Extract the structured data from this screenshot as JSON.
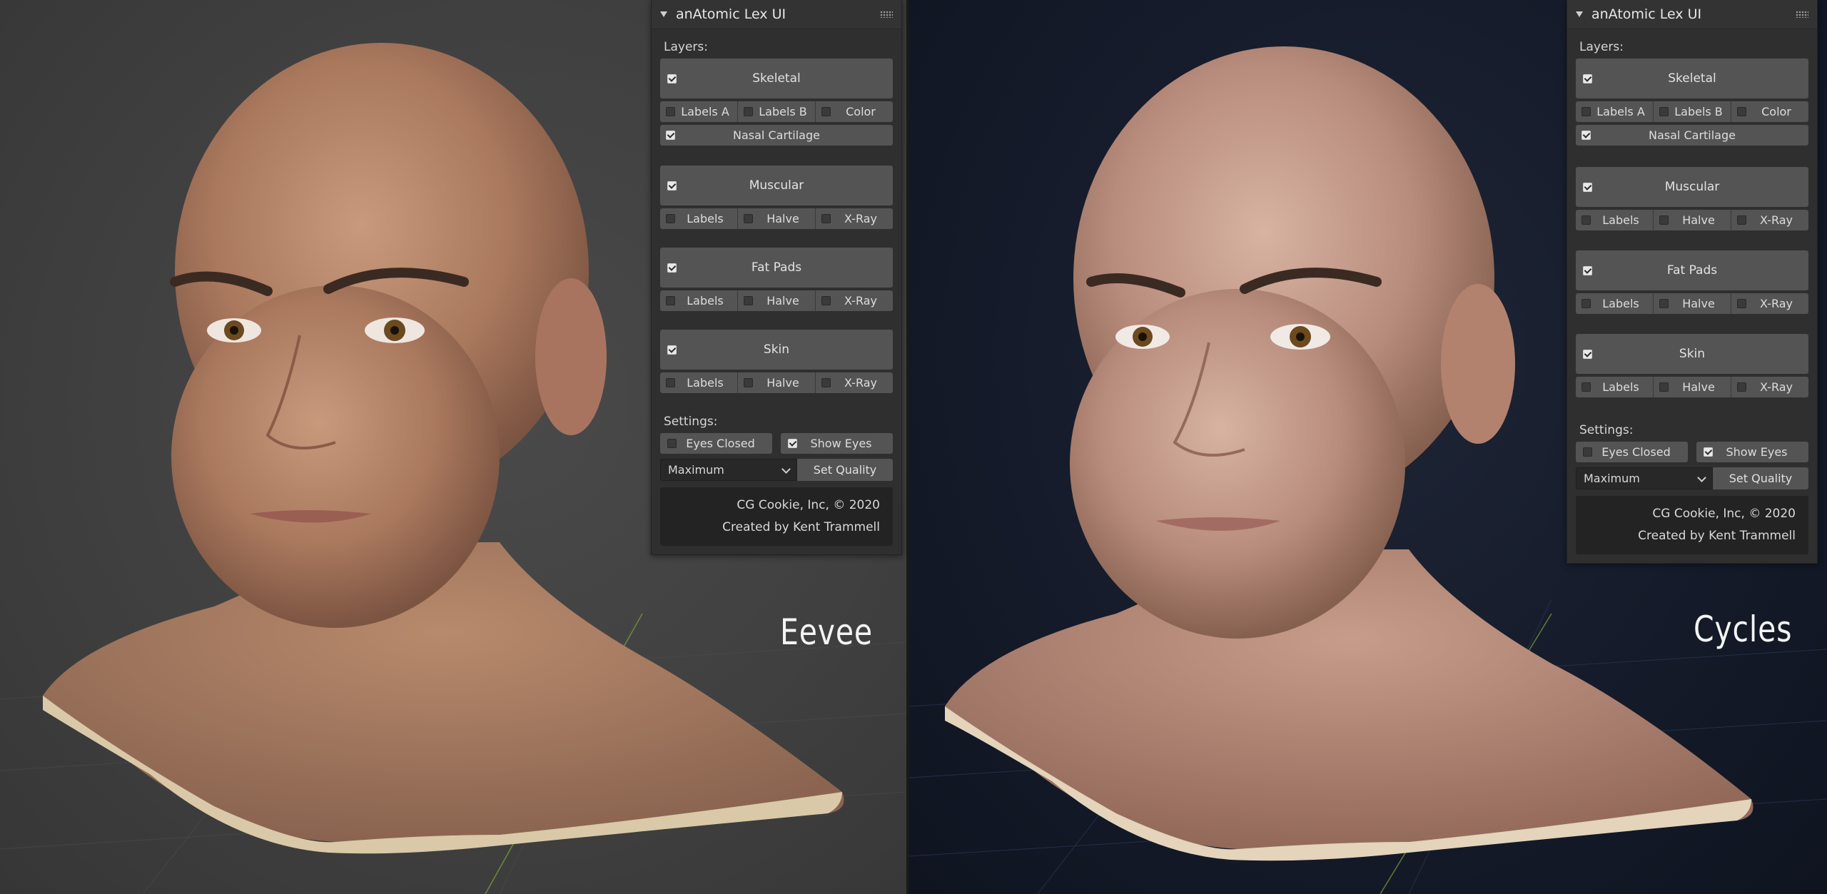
{
  "left": {
    "render_label": "Eevee",
    "panel": {
      "title": "anAtomic Lex UI",
      "layers_label": "Layers:",
      "layers": [
        {
          "name": "Skeletal",
          "checked": true,
          "options": [
            {
              "label": "Labels A",
              "checked": false
            },
            {
              "label": "Labels B",
              "checked": false
            },
            {
              "label": "Color",
              "checked": false
            }
          ],
          "extra": {
            "label": "Nasal Cartilage",
            "checked": true
          }
        },
        {
          "name": "Muscular",
          "checked": true,
          "options": [
            {
              "label": "Labels",
              "checked": false
            },
            {
              "label": "Halve",
              "checked": false
            },
            {
              "label": "X-Ray",
              "checked": false
            }
          ]
        },
        {
          "name": "Fat Pads",
          "checked": true,
          "options": [
            {
              "label": "Labels",
              "checked": false
            },
            {
              "label": "Halve",
              "checked": false
            },
            {
              "label": "X-Ray",
              "checked": false
            }
          ]
        },
        {
          "name": "Skin",
          "checked": true,
          "options": [
            {
              "label": "Labels",
              "checked": false
            },
            {
              "label": "Halve",
              "checked": false
            },
            {
              "label": "X-Ray",
              "checked": false
            }
          ]
        }
      ],
      "settings_label": "Settings:",
      "eyes_closed": {
        "label": "Eyes Closed",
        "checked": false
      },
      "show_eyes": {
        "label": "Show Eyes",
        "checked": true
      },
      "quality_value": "Maximum",
      "set_quality": "Set Quality",
      "credit_1": "CG Cookie, Inc, © 2020",
      "credit_2": "Created by Kent Trammell"
    }
  },
  "right": {
    "render_label": "Cycles",
    "panel": {
      "title": "anAtomic Lex UI",
      "layers_label": "Layers:",
      "layers": [
        {
          "name": "Skeletal",
          "checked": true,
          "options": [
            {
              "label": "Labels A",
              "checked": false
            },
            {
              "label": "Labels B",
              "checked": false
            },
            {
              "label": "Color",
              "checked": false
            }
          ],
          "extra": {
            "label": "Nasal Cartilage",
            "checked": true
          }
        },
        {
          "name": "Muscular",
          "checked": true,
          "options": [
            {
              "label": "Labels",
              "checked": false
            },
            {
              "label": "Halve",
              "checked": false
            },
            {
              "label": "X-Ray",
              "checked": false
            }
          ]
        },
        {
          "name": "Fat Pads",
          "checked": true,
          "options": [
            {
              "label": "Labels",
              "checked": false
            },
            {
              "label": "Halve",
              "checked": false
            },
            {
              "label": "X-Ray",
              "checked": false
            }
          ]
        },
        {
          "name": "Skin",
          "checked": true,
          "options": [
            {
              "label": "Labels",
              "checked": false
            },
            {
              "label": "Halve",
              "checked": false
            },
            {
              "label": "X-Ray",
              "checked": false
            }
          ]
        }
      ],
      "settings_label": "Settings:",
      "eyes_closed": {
        "label": "Eyes Closed",
        "checked": false
      },
      "show_eyes": {
        "label": "Show Eyes",
        "checked": true
      },
      "quality_value": "Maximum",
      "set_quality": "Set Quality",
      "credit_1": "CG Cookie, Inc, © 2020",
      "credit_2": "Created by Kent Trammell"
    }
  }
}
